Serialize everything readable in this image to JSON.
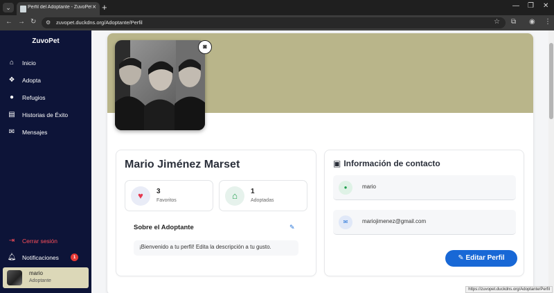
{
  "browser": {
    "tab_title": "Perfil del Adoptante - ZuvoPet",
    "url": "zuvopet.duckdns.org/Adoptante/Perfil",
    "status_url": "https://zuvopet.duckdns.org/Adoptante/Perfil"
  },
  "sidebar": {
    "brand": "ZuvoPet",
    "items": [
      {
        "label": "Inicio",
        "icon": "home-icon"
      },
      {
        "label": "Adopta",
        "icon": "paw-icon"
      },
      {
        "label": "Refugios",
        "icon": "map-marker-icon"
      },
      {
        "label": "Historias de Éxito",
        "icon": "book-icon"
      },
      {
        "label": "Mensajes",
        "icon": "chat-icon"
      }
    ],
    "logout_label": "Cerrar sesión",
    "notifications_label": "Notificaciones",
    "notifications_count": "1",
    "user": {
      "name": "mario",
      "role": "Adoptante"
    }
  },
  "profile": {
    "full_name": "Mario Jiménez Marset",
    "stats": [
      {
        "value": "3",
        "label": "Favoritos",
        "icon": "heart-icon",
        "color": "#e53950"
      },
      {
        "value": "1",
        "label": "Adoptadas",
        "icon": "house-icon",
        "color": "#1e9e4c"
      }
    ],
    "about_title": "Sobre el Adoptante",
    "about_text": "¡Bienvenido a tu perfil! Edita la descripción a tu gusto."
  },
  "contact": {
    "title": "Información de contacto",
    "username": "mario",
    "email": "mariojimenez@gmail.com",
    "edit_label": "Editar Perfil"
  },
  "colors": {
    "sidebar_bg": "#0d1438",
    "cover_bg": "#b9b58a",
    "accent": "#1868d6",
    "logout": "#ff4f5a"
  }
}
